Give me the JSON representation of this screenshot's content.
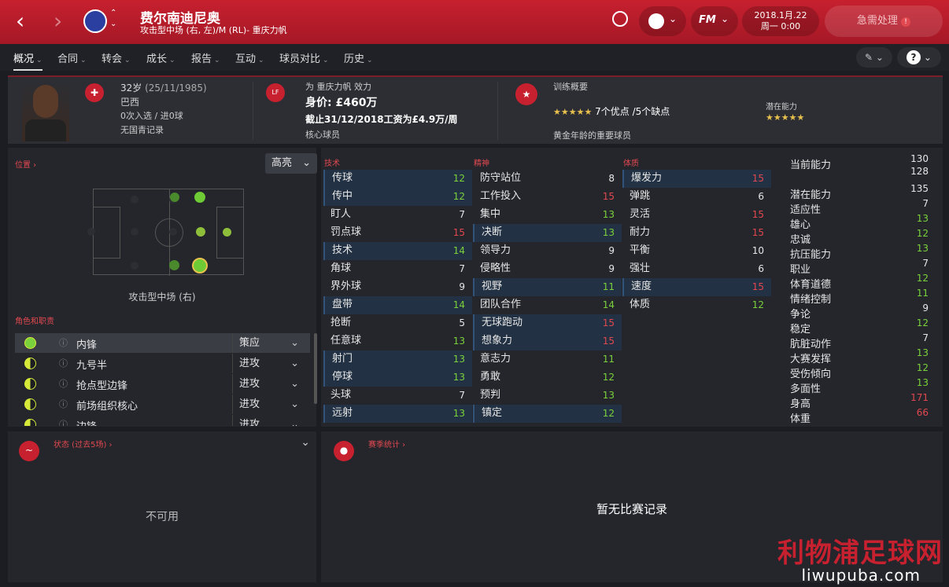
{
  "header": {
    "name": "费尔南迪尼奥",
    "position_line": "攻击型中场 (右, 左)/M (RL)- 重庆力帆",
    "date": "2018.1月.22",
    "day_time": "周一 0:00",
    "urgent": "急需处理",
    "fm_label": "FM"
  },
  "menu": [
    "概况",
    "合同",
    "转会",
    "成长",
    "报告",
    "互动",
    "球员对比",
    "历史"
  ],
  "info": {
    "age": "32岁",
    "dob": "(25/11/1985)",
    "nation": "巴西",
    "caps": "0次入选 / 进0球",
    "youth": "无国青记录",
    "club_play": "为 重庆力帆 效力",
    "value": "身价: £460万",
    "contract": "截止31/12/2018工资为£4.9万/周",
    "squad_status": "核心球员",
    "training_title": "训练概要",
    "strengths": "7个优点 /5个缺点",
    "potential_label": "潜在能力",
    "golden": "黄金年龄的重要球员"
  },
  "panel": {
    "position_link": "位置 ›",
    "highlight": "高亮",
    "position_name": "攻击型中场 (右)",
    "roles_title": "角色和职责",
    "tech": "技术",
    "mental": "精神",
    "physical": "体质"
  },
  "technical": [
    [
      "传球",
      "12",
      1,
      "green"
    ],
    [
      "传中",
      "12",
      1,
      "green"
    ],
    [
      "盯人",
      "7",
      0,
      "white"
    ],
    [
      "罚点球",
      "15",
      0,
      "red"
    ],
    [
      "技术",
      "14",
      1,
      "green"
    ],
    [
      "角球",
      "7",
      0,
      "white"
    ],
    [
      "界外球",
      "9",
      0,
      "white"
    ],
    [
      "盘带",
      "14",
      1,
      "green"
    ],
    [
      "抢断",
      "5",
      0,
      "white"
    ],
    [
      "任意球",
      "13",
      0,
      "green"
    ],
    [
      "射门",
      "13",
      1,
      "green"
    ],
    [
      "停球",
      "13",
      1,
      "green"
    ],
    [
      "头球",
      "7",
      0,
      "white"
    ],
    [
      "远射",
      "13",
      1,
      "green"
    ]
  ],
  "mentals": [
    [
      "防守站位",
      "8",
      0,
      "white"
    ],
    [
      "工作投入",
      "15",
      0,
      "red"
    ],
    [
      "集中",
      "13",
      0,
      "green"
    ],
    [
      "决断",
      "13",
      1,
      "green"
    ],
    [
      "领导力",
      "9",
      0,
      "white"
    ],
    [
      "侵略性",
      "9",
      0,
      "white"
    ],
    [
      "视野",
      "11",
      1,
      "green"
    ],
    [
      "团队合作",
      "14",
      0,
      "green"
    ],
    [
      "无球跑动",
      "15",
      1,
      "red"
    ],
    [
      "想象力",
      "15",
      1,
      "red"
    ],
    [
      "意志力",
      "11",
      0,
      "green"
    ],
    [
      "勇敢",
      "12",
      0,
      "green"
    ],
    [
      "预判",
      "13",
      0,
      "green"
    ],
    [
      "镇定",
      "12",
      1,
      "green"
    ]
  ],
  "physicals": [
    [
      "爆发力",
      "15",
      1,
      "red"
    ],
    [
      "弹跳",
      "6",
      0,
      "white"
    ],
    [
      "灵活",
      "15",
      0,
      "red"
    ],
    [
      "耐力",
      "15",
      0,
      "red"
    ],
    [
      "平衡",
      "10",
      0,
      "white"
    ],
    [
      "强壮",
      "6",
      0,
      "white"
    ],
    [
      "速度",
      "15",
      1,
      "red"
    ],
    [
      "体质",
      "12",
      0,
      "green"
    ]
  ],
  "hidden": [
    [
      "当前能力",
      "130",
      "white"
    ],
    [
      "",
      "128",
      "white"
    ],
    [
      "潜在能力",
      "135",
      "white"
    ],
    [
      "适应性",
      "7",
      "white"
    ],
    [
      "雄心",
      "13",
      "green"
    ],
    [
      "忠诚",
      "12",
      "green"
    ],
    [
      "抗压能力",
      "13",
      "green"
    ],
    [
      "职业",
      "7",
      "white"
    ],
    [
      "体育道德",
      "12",
      "green"
    ],
    [
      "情绪控制",
      "11",
      "green"
    ],
    [
      "争论",
      "9",
      "white"
    ],
    [
      "稳定",
      "12",
      "green"
    ],
    [
      "肮脏动作",
      "7",
      "white"
    ],
    [
      "大赛发挥",
      "13",
      "green"
    ],
    [
      "受伤倾向",
      "12",
      "green"
    ],
    [
      "多面性",
      "13",
      "green"
    ],
    [
      "身高",
      "171",
      "red"
    ],
    [
      "体重",
      "66",
      "red"
    ]
  ],
  "roles": [
    [
      "内锋",
      "策应"
    ],
    [
      "九号半",
      "进攻"
    ],
    [
      "抢点型边锋",
      "进攻"
    ],
    [
      "前场组织核心",
      "进攻"
    ],
    [
      "边锋",
      "进攻"
    ]
  ],
  "bottom": {
    "form_title": "状态 (过去5场) ›",
    "form_empty": "不可用",
    "season_title": "赛季统计 ›",
    "season_empty": "暂无比赛记录"
  },
  "watermark": {
    "text": "利物浦足球网",
    "url": "liwupuba.com"
  },
  "colors": {
    "accent": "#c7202f",
    "green": "#7ad13b",
    "red": "#e2484f"
  }
}
